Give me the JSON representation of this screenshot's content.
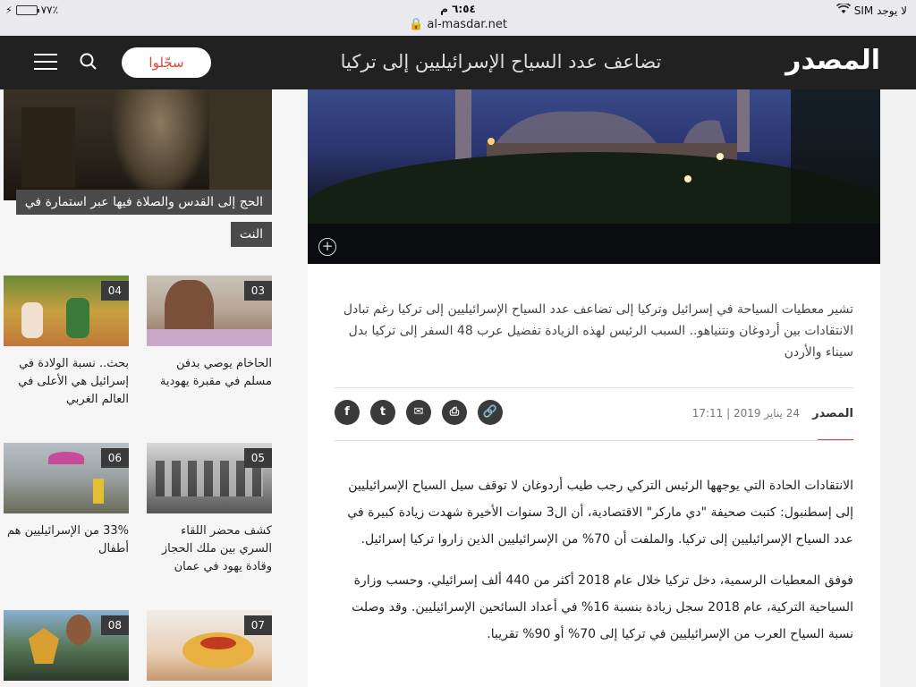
{
  "status_bar": {
    "carrier": "لا يوجد SIM",
    "time": "٦:٥٤ م",
    "url": "al-masdar.net",
    "battery": "٧٧٪",
    "battery_level": 0.77
  },
  "header": {
    "logo": "المصدر",
    "title": "تضاعف عدد السياح الإسرائيليين إلى تركيا",
    "signup_label": "سجّلوا"
  },
  "sidebar": {
    "hero_caption": "الحج إلى القدس والصلاة فيها عبر استمارة في النت",
    "cards": [
      {
        "num": "03",
        "title": "الحاخام يوصي بدفن مسلم في مقبرة يهودية"
      },
      {
        "num": "04",
        "title": "بحث.. نسبة الولادة في إسرائيل هي الأعلى في العالم الغربي"
      },
      {
        "num": "05",
        "title": "كشف محضر اللقاء السري بين ملك الحجاز وقادة يهود في عمان"
      },
      {
        "num": "06",
        "title": "33% من الإسرائيليين هم أطفال"
      },
      {
        "num": "07",
        "title": ""
      },
      {
        "num": "08",
        "title": ""
      }
    ]
  },
  "article": {
    "summary": "تشير معطيات السياحة في إسرائيل وتركيا إلى تضاعف عدد السياح الإسرائيليين إلى تركيا رغم تبادل الانتقادات بين أردوغان ونتنياهو.. السبب الرئيس لهذه الزيادة تفضيل عرب 48 السفر إلى تركيا بدل سيناء والأردن",
    "author": "المصدر",
    "date": "24 يناير 2019 | 17:11",
    "share": {
      "facebook": "f",
      "twitter": "t",
      "email": "✉",
      "print": "⎙",
      "link": "🔗"
    },
    "paragraphs": [
      "الانتقادات الحادة التي يوجهها الرئيس التركي رجب طيب أردوغان لا توقف سيل السياح الإسرائيليين إلى إسطنبول: كتبت صحيفة \"دي ماركر\" الاقتصادية، أن ال3 سنوات الأخيرة شهدت زيادة كبيرة في عدد السياح الإسرائيليين إلى تركيا. والملفت أن 70% من الإسرائيليين الذين زاروا تركيا إسرائيل.",
      "فوفق المعطيات الرسمية، دخل تركيا خلال عام 2018 أكثر من 440 ألف إسرائيلي. وحسب وزارة السياحية التركية، عام 2018 سجل زيادة بنسبة 16% في أعداد السائحين الإسرائيليين. وقد وصلت نسبة السياح العرب من الإسرائيليين في تركيا إلى 70% أو 90% تقريبا."
    ]
  }
}
